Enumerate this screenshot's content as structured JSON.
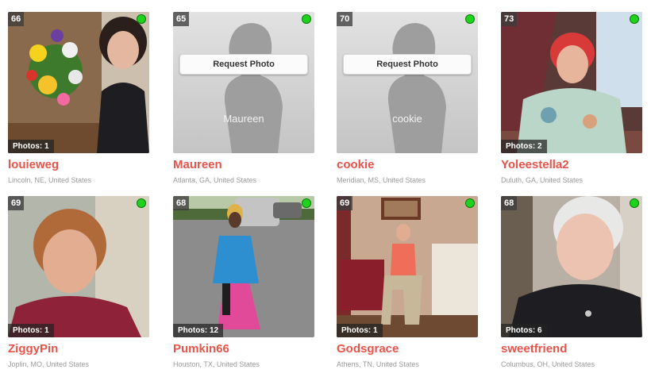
{
  "profiles": [
    {
      "age": "66",
      "online": true,
      "username": "louieweg",
      "location": "Lincoln, NE, United States",
      "photos": "Photos: 1",
      "has_photo": true
    },
    {
      "age": "65",
      "online": true,
      "username": "Maureen",
      "location": "Atlanta, GA, United States",
      "has_photo": false,
      "request_label": "Request Photo",
      "placeholder_name": "Maureen"
    },
    {
      "age": "70",
      "online": true,
      "username": "cookie",
      "location": "Meridian, MS, United States",
      "has_photo": false,
      "request_label": "Request Photo",
      "placeholder_name": "cookie"
    },
    {
      "age": "73",
      "online": true,
      "username": "Yoleestella2",
      "location": "Duluth, GA, United States",
      "photos": "Photos: 2",
      "has_photo": true
    },
    {
      "age": "69",
      "online": true,
      "username": "ZiggyPin",
      "location": "Joplin, MO, United States",
      "photos": "Photos: 1",
      "has_photo": true
    },
    {
      "age": "68",
      "online": true,
      "username": "Pumkin66",
      "location": "Houston, TX, United States",
      "photos": "Photos: 12",
      "has_photo": true
    },
    {
      "age": "69",
      "online": true,
      "username": "Godsgrace",
      "location": "Athens, TN, United States",
      "photos": "Photos: 1",
      "has_photo": true
    },
    {
      "age": "68",
      "online": true,
      "username": "sweetfriend",
      "location": "Columbus, OH, United States",
      "photos": "Photos: 6",
      "has_photo": true
    }
  ],
  "colors": {
    "username": "#e8534a",
    "online": "#1ed21e",
    "location": "#9a9a9a"
  }
}
